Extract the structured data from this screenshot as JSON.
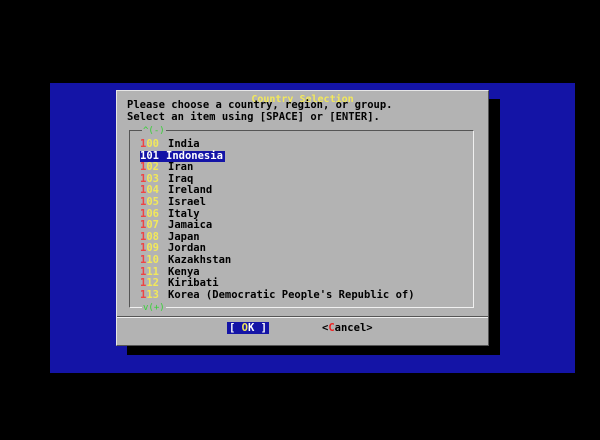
{
  "dialog": {
    "title": "Country Selection",
    "prompt_line1": "Please choose a country, region, or group.",
    "prompt_line2": "Select an item using [SPACE] or [ENTER].",
    "scroll_up_indicator": "^(-)",
    "scroll_down_indicator": "v(+)"
  },
  "list": {
    "selected_index": 1,
    "items": [
      {
        "tag": "100",
        "label": "India"
      },
      {
        "tag": "101",
        "label": "Indonesia"
      },
      {
        "tag": "102",
        "label": "Iran"
      },
      {
        "tag": "103",
        "label": "Iraq"
      },
      {
        "tag": "104",
        "label": "Ireland"
      },
      {
        "tag": "105",
        "label": "Israel"
      },
      {
        "tag": "106",
        "label": "Italy"
      },
      {
        "tag": "107",
        "label": "Jamaica"
      },
      {
        "tag": "108",
        "label": "Japan"
      },
      {
        "tag": "109",
        "label": "Jordan"
      },
      {
        "tag": "110",
        "label": "Kazakhstan"
      },
      {
        "tag": "111",
        "label": "Kenya"
      },
      {
        "tag": "112",
        "label": "Kiribati"
      },
      {
        "tag": "113",
        "label": "Korea (Democratic People's Republic of)"
      }
    ]
  },
  "buttons": {
    "ok_label": "OK",
    "cancel_label": "Cancel"
  },
  "colors": {
    "backdrop": "#1414a6",
    "dialog": "#b3b3b3",
    "title": "#f2e85a",
    "hotkey": "#ee4444"
  }
}
